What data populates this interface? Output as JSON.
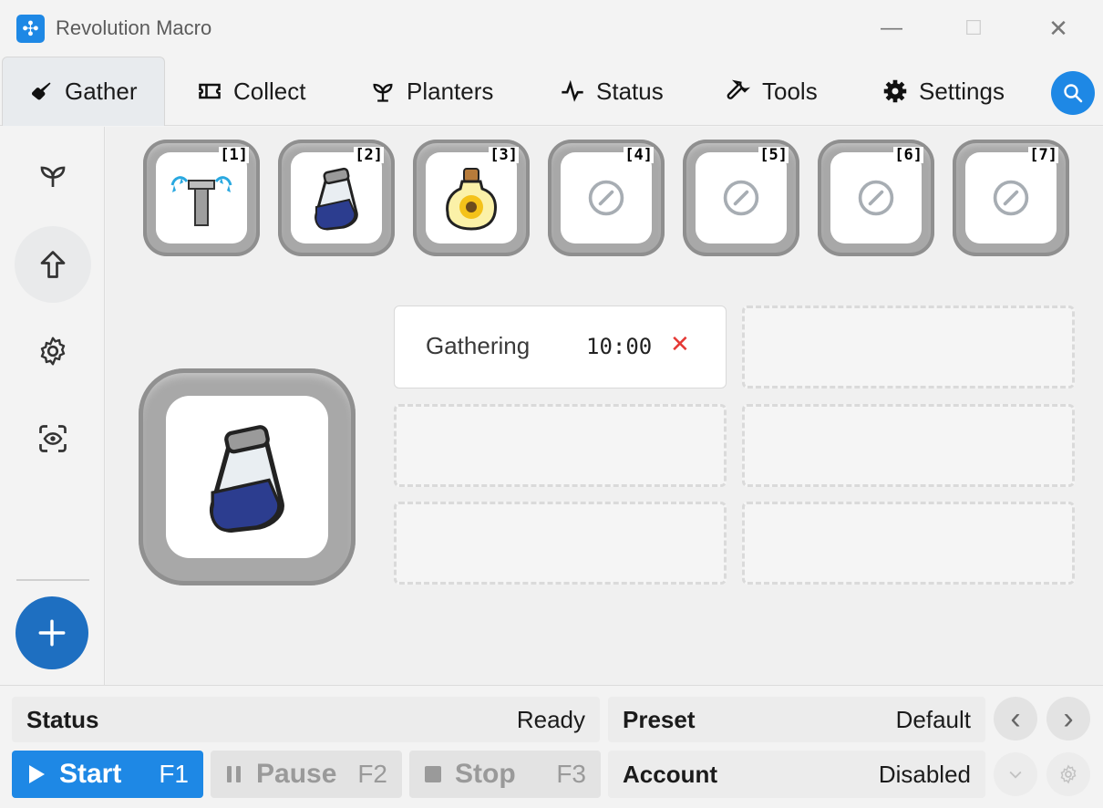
{
  "window": {
    "title": "Revolution Macro",
    "minimize_glyph": "—",
    "maximize_glyph": "☐",
    "close_glyph": "✕"
  },
  "tabs": [
    {
      "label": "Gather",
      "icon": "shovel-icon",
      "active": true
    },
    {
      "label": "Collect",
      "icon": "ticket-icon"
    },
    {
      "label": "Planters",
      "icon": "sprout-icon"
    },
    {
      "label": "Status",
      "icon": "pulse-icon"
    },
    {
      "label": "Tools",
      "icon": "wrench-icon"
    },
    {
      "label": "Settings",
      "icon": "gear-icon"
    }
  ],
  "sidebar": {
    "items": [
      {
        "icon": "sprout-icon"
      },
      {
        "icon": "arrow-up-icon",
        "active": true
      },
      {
        "icon": "gear-icon"
      },
      {
        "icon": "eye-scan-icon"
      }
    ],
    "add_icon": "plus-icon"
  },
  "hotbar": {
    "slots": [
      {
        "number": "[1]",
        "item": "sprinkler-icon"
      },
      {
        "number": "[2]",
        "item": "blue-extract-jar-icon"
      },
      {
        "number": "[3]",
        "item": "sunflower-jar-icon"
      },
      {
        "number": "[4]",
        "item": "empty-slot-icon"
      },
      {
        "number": "[5]",
        "item": "empty-slot-icon"
      },
      {
        "number": "[6]",
        "item": "empty-slot-icon"
      },
      {
        "number": "[7]",
        "item": "empty-slot-icon"
      }
    ]
  },
  "selected_item": {
    "item": "blue-extract-jar-icon"
  },
  "tasks": [
    {
      "label": "Gathering",
      "time": "10:00",
      "remove_glyph": "✕"
    }
  ],
  "bottom": {
    "status_key": "Status",
    "status_value": "Ready",
    "preset_key": "Preset",
    "preset_value": "Default",
    "account_key": "Account",
    "account_value": "Disabled",
    "start_label": "Start",
    "start_hotkey": "F1",
    "pause_label": "Pause",
    "pause_hotkey": "F2",
    "stop_label": "Stop",
    "stop_hotkey": "F3",
    "prev_glyph": "‹",
    "next_glyph": "›"
  },
  "colors": {
    "accent": "#1e88e5",
    "accent_dark": "#1e6fc1",
    "remove": "#e53935"
  }
}
